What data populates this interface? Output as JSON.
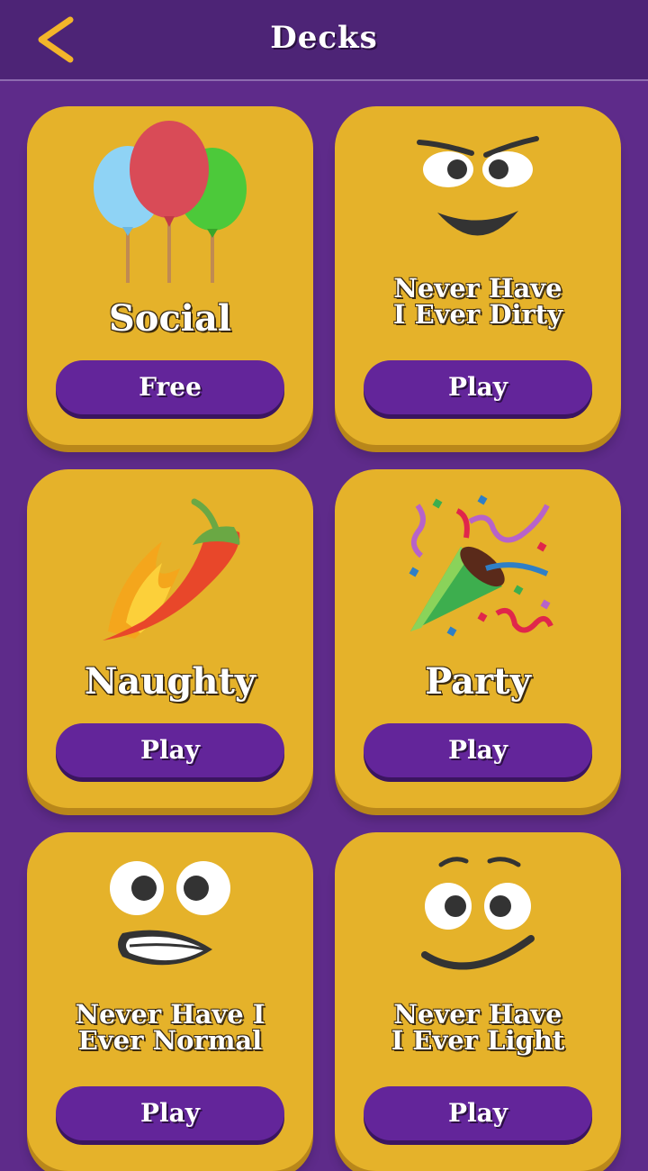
{
  "header": {
    "title": "Decks",
    "back_icon": "chevron-left-icon"
  },
  "colors": {
    "background": "#5e2b8a",
    "card": "#e5b22a",
    "button": "#63259a",
    "back_arrow": "#f3b52a"
  },
  "decks": [
    {
      "name": "Social",
      "button_label": "Free",
      "icon": "balloons-icon"
    },
    {
      "name_line1": "Never Have",
      "name_line2": "I Ever Dirty",
      "button_label": "Play",
      "icon": "smirk-face-icon"
    },
    {
      "name": "Naughty",
      "button_label": "Play",
      "icon": "hot-pepper-icon"
    },
    {
      "name": "Party",
      "button_label": "Play",
      "icon": "party-popper-icon"
    },
    {
      "name_line1": "Never Have I",
      "name_line2": "Ever Normal",
      "button_label": "Play",
      "icon": "grimace-face-icon"
    },
    {
      "name_line1": "Never Have",
      "name_line2": "I Ever Light",
      "button_label": "Play",
      "icon": "smile-face-icon"
    }
  ]
}
